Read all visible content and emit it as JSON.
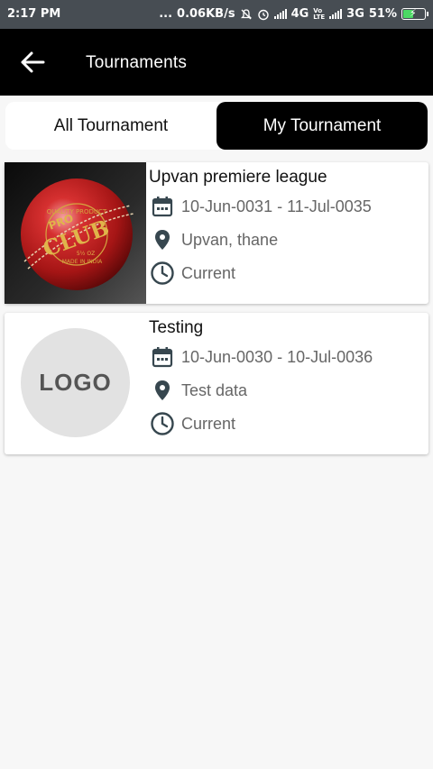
{
  "status_bar": {
    "time": "2:17 PM",
    "dots": "...",
    "speed": "0.06KB/s",
    "volte_top": "Vo",
    "volte_bottom": "LTE",
    "network1": "4G",
    "network2": "3G",
    "battery_pct": "51%",
    "battery_level": 0.51,
    "icons": [
      "mute-icon",
      "alarm-icon",
      "signal-icon",
      "signal-icon",
      "battery-charging-icon"
    ]
  },
  "appbar": {
    "title": "Tournaments",
    "back_icon": "arrow-left-icon"
  },
  "tabs": [
    {
      "label": "All Tournament",
      "active": false
    },
    {
      "label": "My Tournament",
      "active": true
    }
  ],
  "tournaments": [
    {
      "name": "Upvan premiere league",
      "dates": "10-Jun-0031 - 11-Jul-0035",
      "location": "Upvan, thane",
      "status": "Current",
      "image": "cricket-ball-image",
      "image_text": {
        "top": "PRO",
        "main": "CLUB",
        "weight": "5½ OZ",
        "ring_top": "QUALITY PRODUCT",
        "ring_bottom": "MADE IN INDIA"
      }
    },
    {
      "name": "Testing",
      "dates": "10-Jun-0030 - 10-Jul-0036",
      "location": "Test data",
      "status": "Current",
      "image": "logo-placeholder",
      "logo_text": "LOGO"
    }
  ],
  "colors": {
    "status_bar_bg": "#474d53",
    "appbar_bg": "#000000",
    "active_tab_bg": "#000000",
    "icon_color": "#37474f",
    "secondary_text": "#666666",
    "battery_fill": "#4cd964"
  }
}
